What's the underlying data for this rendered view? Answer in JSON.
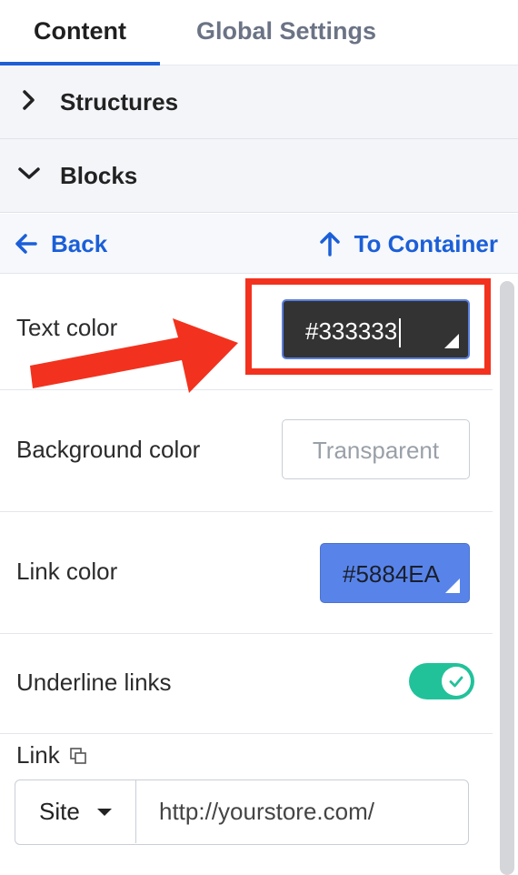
{
  "tabs": [
    {
      "label": "Content",
      "active": true
    },
    {
      "label": "Global Settings",
      "active": false
    }
  ],
  "sections": {
    "structures": {
      "label": "Structures",
      "expanded": false
    },
    "blocks": {
      "label": "Blocks",
      "expanded": true
    }
  },
  "nav": {
    "back_label": "Back",
    "to_container_label": "To Container"
  },
  "properties": {
    "text_color": {
      "label": "Text color",
      "value": "#333333"
    },
    "background_color": {
      "label": "Background color",
      "placeholder": "Transparent"
    },
    "link_color": {
      "label": "Link color",
      "value": "#5884EA",
      "display": "#5884EA"
    },
    "underline_links": {
      "label": "Underline links",
      "enabled": true
    }
  },
  "link": {
    "label": "Link",
    "type_selected": "Site",
    "url": "http://yourstore.com/"
  },
  "colors": {
    "accent": "#1d5fd6",
    "toggle_on": "#21c29a",
    "annotation": "#f2321e"
  }
}
